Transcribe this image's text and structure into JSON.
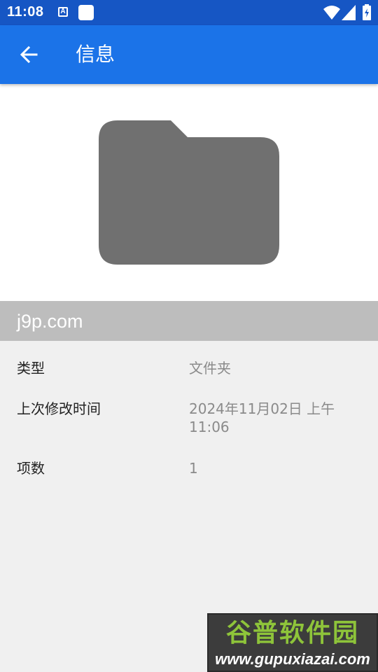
{
  "status_bar": {
    "time": "11:08",
    "a_icon_letter": "A"
  },
  "app_bar": {
    "title": "信息"
  },
  "file": {
    "name": "j9p.com"
  },
  "details": [
    {
      "label": "类型",
      "value": "文件夹"
    },
    {
      "label": "上次修改时间",
      "value": "2024年11月02日 上午11:06"
    },
    {
      "label": "项数",
      "value": "1"
    }
  ],
  "watermark": {
    "title": "谷普软件园",
    "url": "www.gupuxiazai.com"
  },
  "colors": {
    "status_bar": "#1656c4",
    "app_bar": "#1b73e8",
    "folder_icon": "#707070",
    "name_bar": "#bdbdbd",
    "background": "#f0f0f0"
  },
  "icons": {
    "back": "arrow-back-icon",
    "preview": "folder-icon",
    "wifi": "wifi-icon",
    "signal": "signal-icon",
    "battery": "battery-icon"
  }
}
